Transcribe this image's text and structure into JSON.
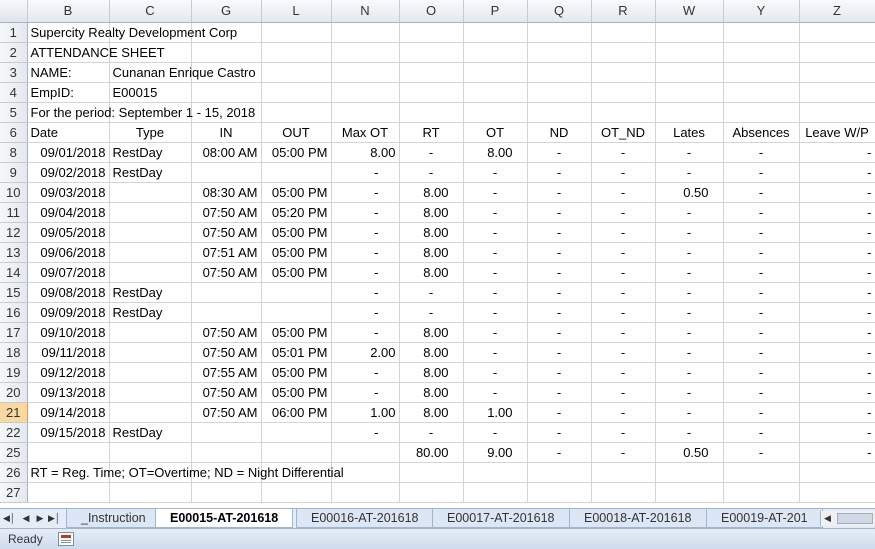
{
  "columns": [
    "B",
    "C",
    "G",
    "L",
    "N",
    "O",
    "P",
    "Q",
    "R",
    "W",
    "Y",
    "Z"
  ],
  "header_block": {
    "company": "Supercity Realty Development Corp",
    "title": "ATTENDANCE SHEET",
    "name_label": "NAME:",
    "name_value": "Cunanan Enrique Castro",
    "empid_label": "EmpID:",
    "empid_value": "E00015",
    "period": "For the period: September 1 - 15, 2018"
  },
  "row_numbers": {
    "r1": "1",
    "r2": "2",
    "r3": "3",
    "r4": "4",
    "r5": "5",
    "r6": "6",
    "r25": "25",
    "r26": "26",
    "r27": "27"
  },
  "table_headers": [
    "Date",
    "Type",
    "IN",
    "OUT",
    "Max OT",
    "RT",
    "OT",
    "ND",
    "OT_ND",
    "Lates",
    "Absences",
    "Leave W/P"
  ],
  "rows": [
    {
      "rownum": "8",
      "date": "09/01/2018",
      "type": "RestDay",
      "in": "08:00 AM",
      "out": "05:00 PM",
      "maxot": "8.00",
      "rt": "-",
      "ot": "8.00",
      "nd": "-",
      "otnd": "-",
      "lates": "-",
      "absences": "-",
      "leave": "-"
    },
    {
      "rownum": "9",
      "date": "09/02/2018",
      "type": "RestDay",
      "in": "",
      "out": "",
      "maxot": "-",
      "rt": "-",
      "ot": "-",
      "nd": "-",
      "otnd": "-",
      "lates": "-",
      "absences": "-",
      "leave": "-"
    },
    {
      "rownum": "10",
      "date": "09/03/2018",
      "type": "",
      "in": "08:30 AM",
      "out": "05:00 PM",
      "maxot": "-",
      "rt": "8.00",
      "ot": "-",
      "nd": "-",
      "otnd": "-",
      "lates": "0.50",
      "absences": "-",
      "leave": "-"
    },
    {
      "rownum": "11",
      "date": "09/04/2018",
      "type": "",
      "in": "07:50 AM",
      "out": "05:20 PM",
      "maxot": "-",
      "rt": "8.00",
      "ot": "-",
      "nd": "-",
      "otnd": "-",
      "lates": "-",
      "absences": "-",
      "leave": "-"
    },
    {
      "rownum": "12",
      "date": "09/05/2018",
      "type": "",
      "in": "07:50 AM",
      "out": "05:00 PM",
      "maxot": "-",
      "rt": "8.00",
      "ot": "-",
      "nd": "-",
      "otnd": "-",
      "lates": "-",
      "absences": "-",
      "leave": "-"
    },
    {
      "rownum": "13",
      "date": "09/06/2018",
      "type": "",
      "in": "07:51 AM",
      "out": "05:00 PM",
      "maxot": "-",
      "rt": "8.00",
      "ot": "-",
      "nd": "-",
      "otnd": "-",
      "lates": "-",
      "absences": "-",
      "leave": "-"
    },
    {
      "rownum": "14",
      "date": "09/07/2018",
      "type": "",
      "in": "07:50 AM",
      "out": "05:00 PM",
      "maxot": "-",
      "rt": "8.00",
      "ot": "-",
      "nd": "-",
      "otnd": "-",
      "lates": "-",
      "absences": "-",
      "leave": "-"
    },
    {
      "rownum": "15",
      "date": "09/08/2018",
      "type": "RestDay",
      "in": "",
      "out": "",
      "maxot": "-",
      "rt": "-",
      "ot": "-",
      "nd": "-",
      "otnd": "-",
      "lates": "-",
      "absences": "-",
      "leave": "-"
    },
    {
      "rownum": "16",
      "date": "09/09/2018",
      "type": "RestDay",
      "in": "",
      "out": "",
      "maxot": "-",
      "rt": "-",
      "ot": "-",
      "nd": "-",
      "otnd": "-",
      "lates": "-",
      "absences": "-",
      "leave": "-"
    },
    {
      "rownum": "17",
      "date": "09/10/2018",
      "type": "",
      "in": "07:50 AM",
      "out": "05:00 PM",
      "maxot": "-",
      "rt": "8.00",
      "ot": "-",
      "nd": "-",
      "otnd": "-",
      "lates": "-",
      "absences": "-",
      "leave": "-"
    },
    {
      "rownum": "18",
      "date": "09/11/2018",
      "type": "",
      "in": "07:50 AM",
      "out": "05:01 PM",
      "maxot": "2.00",
      "rt": "8.00",
      "ot": "-",
      "nd": "-",
      "otnd": "-",
      "lates": "-",
      "absences": "-",
      "leave": "-"
    },
    {
      "rownum": "19",
      "date": "09/12/2018",
      "type": "",
      "in": "07:55 AM",
      "out": "05:00 PM",
      "maxot": "-",
      "rt": "8.00",
      "ot": "-",
      "nd": "-",
      "otnd": "-",
      "lates": "-",
      "absences": "-",
      "leave": "-"
    },
    {
      "rownum": "20",
      "date": "09/13/2018",
      "type": "",
      "in": "07:50 AM",
      "out": "05:00 PM",
      "maxot": "-",
      "rt": "8.00",
      "ot": "-",
      "nd": "-",
      "otnd": "-",
      "lates": "-",
      "absences": "-",
      "leave": "-"
    },
    {
      "rownum": "21",
      "date": "09/14/2018",
      "type": "",
      "in": "07:50 AM",
      "out": "06:00 PM",
      "maxot": "1.00",
      "rt": "8.00",
      "ot": "1.00",
      "nd": "-",
      "otnd": "-",
      "lates": "-",
      "absences": "-",
      "leave": "-"
    },
    {
      "rownum": "22",
      "date": "09/15/2018",
      "type": "RestDay",
      "in": "",
      "out": "",
      "maxot": "-",
      "rt": "-",
      "ot": "-",
      "nd": "-",
      "otnd": "-",
      "lates": "-",
      "absences": "-",
      "leave": "-"
    }
  ],
  "totals": {
    "rt": "80.00",
    "ot": "9.00",
    "nd": "-",
    "otnd": "-",
    "lates": "0.50",
    "absences": "-",
    "leave": "-"
  },
  "legend": "RT = Reg. Time;  OT=Overtime;  ND = Night Differential",
  "sheet_tabs": [
    "_Instruction",
    "E00015-AT-201618",
    "E00016-AT-201618",
    "E00017-AT-201618",
    "E00018-AT-201618",
    "E00019-AT-201"
  ],
  "active_tab": "E00015-AT-201618",
  "status": {
    "ready": "Ready"
  },
  "selected_row": "21"
}
